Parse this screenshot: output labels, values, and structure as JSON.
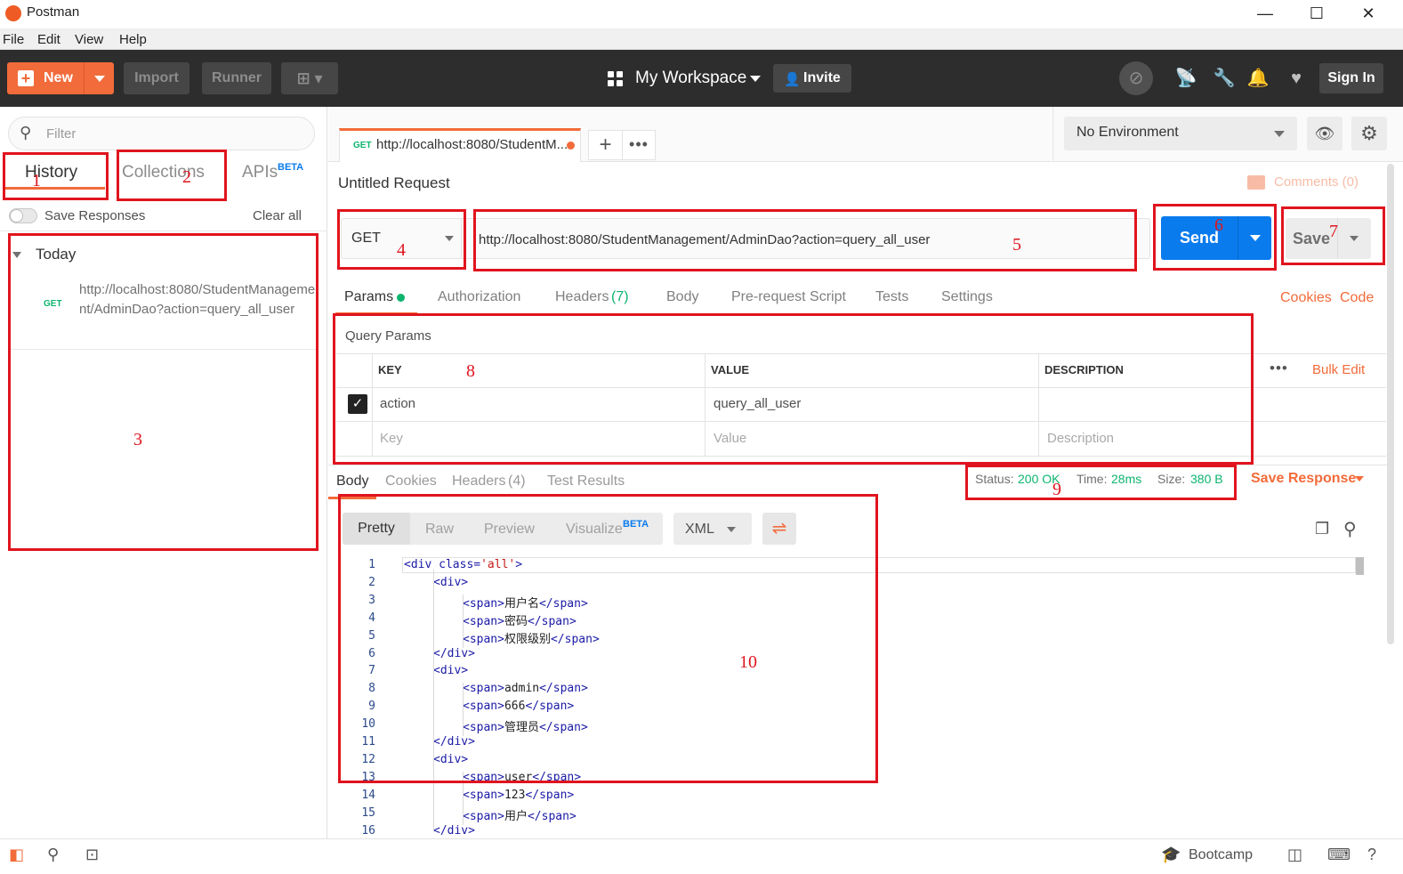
{
  "window": {
    "title": "Postman",
    "minimize": "—",
    "maximize": "☐",
    "close": "✕"
  },
  "menubar": [
    "File",
    "Edit",
    "View",
    "Help"
  ],
  "header": {
    "new_label": "New",
    "import_label": "Import",
    "runner_label": "Runner",
    "workspace_label": "My Workspace",
    "invite_label": "Invite",
    "signin_label": "Sign In"
  },
  "sidebar": {
    "filter_placeholder": "Filter",
    "tabs": {
      "history": "History",
      "collections": "Collections",
      "apis": "APIs",
      "apis_badge": "BETA"
    },
    "save_responses_label": "Save Responses",
    "clear_all_label": "Clear all",
    "group_label": "Today",
    "history_items": [
      {
        "method": "GET",
        "url": "http://localhost:8080/StudentManagement/AdminDao?action=query_all_user"
      }
    ]
  },
  "request_tab": {
    "method": "GET",
    "title": "http://localhost:8080/StudentM...",
    "add": "+",
    "more": "•••"
  },
  "environment": {
    "selected": "No Environment"
  },
  "request": {
    "name": "Untitled Request",
    "comments_label": "Comments (0)",
    "method": "GET",
    "url": "http://localhost:8080/StudentManagement/AdminDao?action=query_all_user",
    "send_label": "Send",
    "save_label": "Save",
    "tabs": {
      "params": "Params",
      "authorization": "Authorization",
      "headers": "Headers",
      "headers_count": "(7)",
      "body": "Body",
      "prerequest": "Pre-request Script",
      "tests": "Tests",
      "settings": "Settings"
    },
    "cookies_link": "Cookies",
    "code_link": "Code"
  },
  "query_params": {
    "title": "Query Params",
    "columns": {
      "key": "KEY",
      "value": "VALUE",
      "description": "DESCRIPTION"
    },
    "more": "•••",
    "bulk_edit": "Bulk Edit",
    "rows": [
      {
        "checked": true,
        "key": "action",
        "value": "query_all_user",
        "description": ""
      }
    ],
    "placeholders": {
      "key": "Key",
      "value": "Value",
      "description": "Description"
    }
  },
  "response": {
    "tabs": {
      "body": "Body",
      "cookies": "Cookies",
      "headers": "Headers",
      "headers_count": "(4)",
      "test_results": "Test Results"
    },
    "status_label": "Status:",
    "status_value": "200 OK",
    "time_label": "Time:",
    "time_value": "28ms",
    "size_label": "Size:",
    "size_value": "380 B",
    "save_response_label": "Save Response",
    "view_tabs": {
      "pretty": "Pretty",
      "raw": "Raw",
      "preview": "Preview",
      "visualize": "Visualize",
      "visualize_badge": "BETA"
    },
    "format": "XML",
    "code_lines": [
      {
        "n": "1",
        "indent": 0,
        "open": "<div class=",
        "attr": "'all'",
        "close": ">",
        "text": ""
      },
      {
        "n": "2",
        "indent": 1,
        "open": "<div>",
        "attr": "",
        "close": "",
        "text": ""
      },
      {
        "n": "3",
        "indent": 2,
        "open": "<span>",
        "attr": "",
        "close": "</span>",
        "text": "用户名"
      },
      {
        "n": "4",
        "indent": 2,
        "open": "<span>",
        "attr": "",
        "close": "</span>",
        "text": "密码"
      },
      {
        "n": "5",
        "indent": 2,
        "open": "<span>",
        "attr": "",
        "close": "</span>",
        "text": "权限级别"
      },
      {
        "n": "6",
        "indent": 1,
        "open": "</div>",
        "attr": "",
        "close": "",
        "text": ""
      },
      {
        "n": "7",
        "indent": 1,
        "open": "<div>",
        "attr": "",
        "close": "",
        "text": ""
      },
      {
        "n": "8",
        "indent": 2,
        "open": "<span>",
        "attr": "",
        "close": "</span>",
        "text": "admin"
      },
      {
        "n": "9",
        "indent": 2,
        "open": "<span>",
        "attr": "",
        "close": "</span>",
        "text": "666"
      },
      {
        "n": "10",
        "indent": 2,
        "open": "<span>",
        "attr": "",
        "close": "</span>",
        "text": "管理员"
      },
      {
        "n": "11",
        "indent": 1,
        "open": "</div>",
        "attr": "",
        "close": "",
        "text": ""
      },
      {
        "n": "12",
        "indent": 1,
        "open": "<div>",
        "attr": "",
        "close": "",
        "text": ""
      },
      {
        "n": "13",
        "indent": 2,
        "open": "<span>",
        "attr": "",
        "close": "</span>",
        "text": "user"
      },
      {
        "n": "14",
        "indent": 2,
        "open": "<span>",
        "attr": "",
        "close": "</span>",
        "text": "123"
      },
      {
        "n": "15",
        "indent": 2,
        "open": "<span>",
        "attr": "",
        "close": "</span>",
        "text": "用户"
      },
      {
        "n": "16",
        "indent": 1,
        "open": "</div>",
        "attr": "",
        "close": "",
        "text": ""
      }
    ]
  },
  "statusbar": {
    "bootcamp_label": "Bootcamp"
  },
  "annotations": [
    "1",
    "2",
    "3",
    "4",
    "5",
    "6",
    "7",
    "8",
    "9",
    "10"
  ],
  "colors": {
    "accent": "#f26b3a",
    "send": "#097bed",
    "success": "#0cb56e",
    "annotation": "#e0141e"
  },
  "icons": {
    "sync": "sync-off-icon",
    "satellite": "satellite-icon",
    "wrench": "wrench-icon",
    "bell": "bell-icon",
    "heart": "heart-icon",
    "eye": "eye-icon",
    "gear": "gear-icon",
    "search": "search-icon",
    "copy": "copy-icon",
    "wrap": "wrap-lines-icon"
  }
}
